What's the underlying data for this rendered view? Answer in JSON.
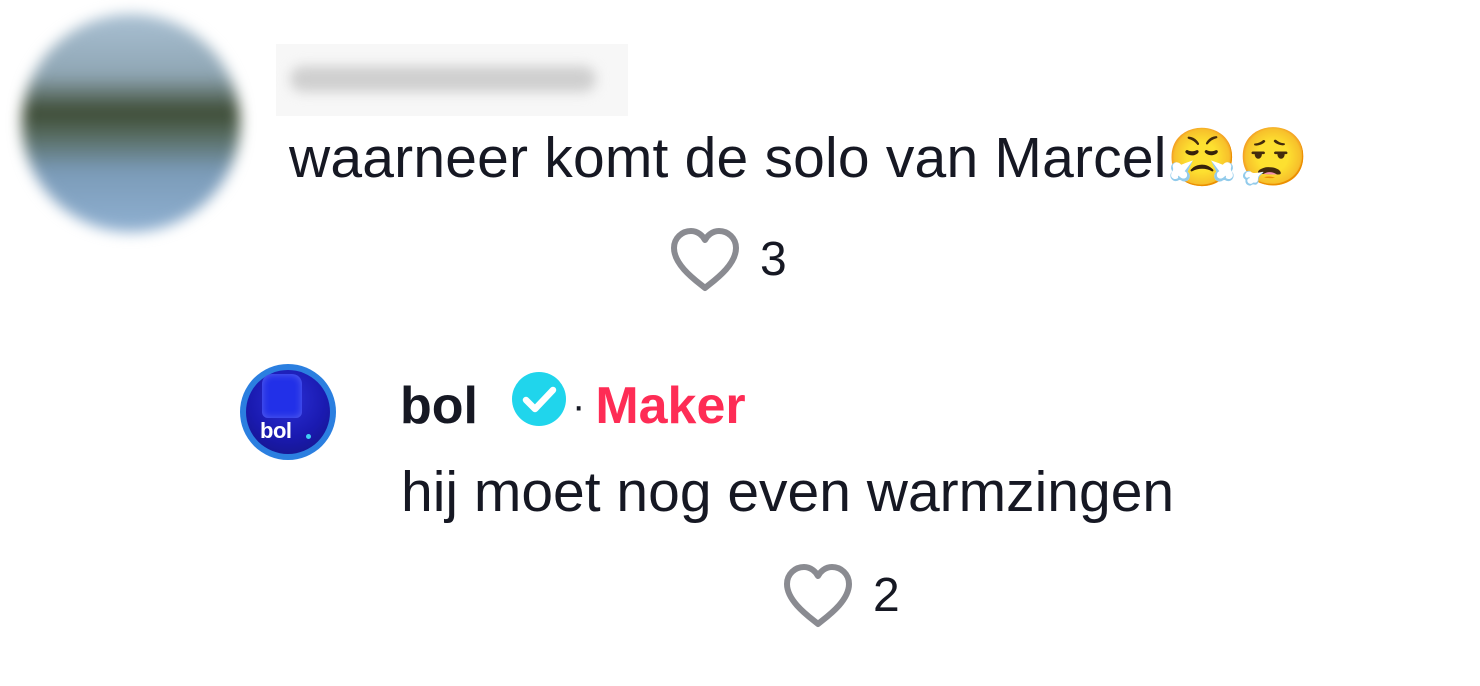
{
  "comments": [
    {
      "author": {
        "username": "",
        "avatar_icon": "blurred-avatar",
        "redacted": true
      },
      "text": "waarneer komt de solo van Marcel",
      "emojis": [
        "😤",
        "😮‍💨"
      ],
      "likes": "3",
      "like_icon": "heart-outline-icon"
    }
  ],
  "replies": [
    {
      "author": {
        "username": "bol",
        "verified": true,
        "verified_icon": "verified-badge-icon",
        "avatar_icon": "bol-logo-avatar",
        "avatar_logo_text": "bol",
        "separator": "·",
        "role_label": "Maker"
      },
      "text": "hij moet nog even warmzingen",
      "likes": "2",
      "like_icon": "heart-outline-icon"
    }
  ],
  "colors": {
    "text": "#161823",
    "maker": "#fe2c55",
    "verified": "#20d5ec",
    "heart_stroke": "#8a8b91",
    "bol_avatar_ring": "#2b7fe0",
    "bol_avatar_fill": "#1a1ab0"
  }
}
